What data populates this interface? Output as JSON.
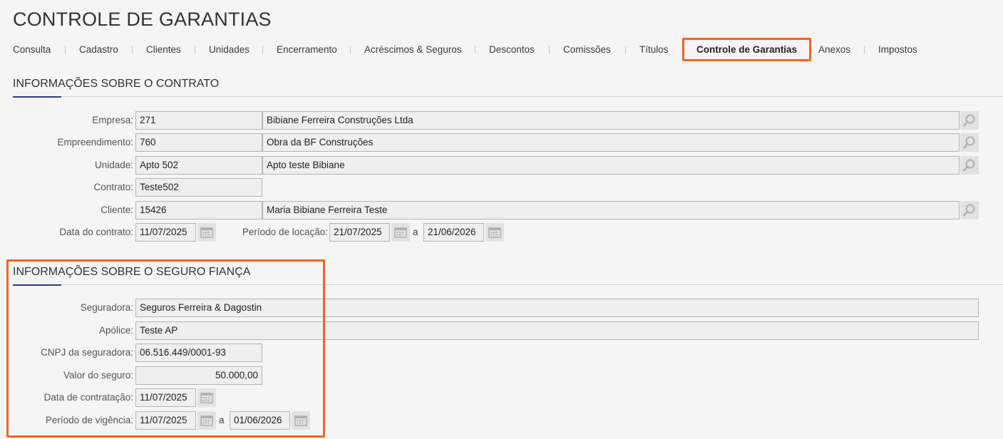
{
  "page_title": "CONTROLE DE GARANTIAS",
  "tabs": [
    {
      "label": "Consulta"
    },
    {
      "label": "Cadastro"
    },
    {
      "label": "Clientes"
    },
    {
      "label": "Unidades"
    },
    {
      "label": "Encerramento"
    },
    {
      "label": "Acréscimos & Seguros"
    },
    {
      "label": "Descontos"
    },
    {
      "label": "Comissões"
    },
    {
      "label": "Títulos"
    },
    {
      "label": "Controle de Garantias",
      "active": true
    },
    {
      "label": "Anexos"
    },
    {
      "label": "Impostos"
    }
  ],
  "contract_section": {
    "title": "INFORMAÇÕES SOBRE O CONTRATO",
    "empresa": {
      "label": "Empresa:",
      "code": "271",
      "name": "Bibiane Ferreira Construções Ltda"
    },
    "empreendimento": {
      "label": "Empreendimento:",
      "code": "760",
      "name": "Obra da BF Construções"
    },
    "unidade": {
      "label": "Unidade:",
      "code": "Apto 502",
      "name": "Apto teste Bibiane"
    },
    "contrato": {
      "label": "Contrato:",
      "value": "Teste502"
    },
    "cliente": {
      "label": "Cliente:",
      "code": "15426",
      "name": "Maria Bibiane Ferreira Teste"
    },
    "data_contrato": {
      "label": "Data do contrato:",
      "value": "11/07/2025"
    },
    "periodo_locacao": {
      "label": "Período de locação:",
      "start": "21/07/2025",
      "sep": "a",
      "end": "21/06/2026"
    }
  },
  "insurance_section": {
    "title": "INFORMAÇÕES SOBRE O SEGURO FIANÇA",
    "seguradora": {
      "label": "Seguradora:",
      "value": "Seguros Ferreira & Dagostin"
    },
    "apolice": {
      "label": "Apólice:",
      "value": "Teste AP"
    },
    "cnpj": {
      "label": "CNPJ da seguradora:",
      "value": "06.516.449/0001-93"
    },
    "valor": {
      "label": "Valor do seguro:",
      "value": "50.000,00"
    },
    "data_contratacao": {
      "label": "Data de contratação:",
      "value": "11/07/2025"
    },
    "periodo_vigencia": {
      "label": "Período de vigência:",
      "start": "11/07/2025",
      "sep": "a",
      "end": "01/06/2026"
    }
  },
  "colors": {
    "accent": "#f26522",
    "rule_accent": "#2a3a8c"
  }
}
